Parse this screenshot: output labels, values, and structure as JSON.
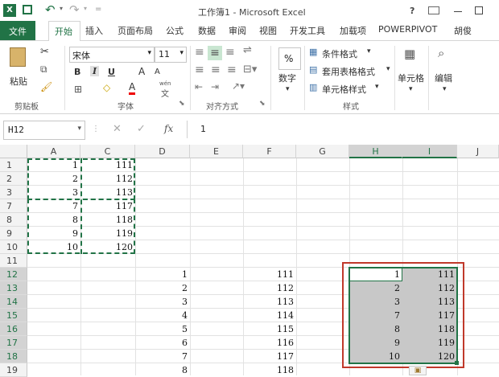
{
  "app": {
    "title": "工作簿1 - Microsoft Excel",
    "help": "?"
  },
  "tabs": [
    "文件",
    "开始",
    "插入",
    "页面布局",
    "公式",
    "数据",
    "审阅",
    "视图",
    "开发工具",
    "加载项",
    "POWERPIVOT",
    "胡俊"
  ],
  "ribbon": {
    "clipboard": {
      "paste": "粘贴",
      "label": "剪贴板"
    },
    "font": {
      "name": "宋体",
      "size": "11",
      "bold": "B",
      "italic": "I",
      "underline": "U",
      "grow": "A",
      "shrink": "A",
      "color_a": "A",
      "label": "字体",
      "wen": "wén",
      "wen_char": "文"
    },
    "alignment": {
      "label": "对齐方式"
    },
    "number": {
      "percent": "%",
      "label": "数字"
    },
    "styles": {
      "conditional": "条件格式",
      "table": "套用表格格式",
      "cell": "单元格样式",
      "label": "样式"
    },
    "cells": {
      "label": "单元格"
    },
    "editing": {
      "label": "编辑"
    }
  },
  "formula_bar": {
    "name_box": "H12",
    "fx": "fx",
    "value": "1"
  },
  "columns": [
    "A",
    "C",
    "D",
    "E",
    "F",
    "G",
    "H",
    "I",
    "J"
  ],
  "row_headers": [
    "1",
    "2",
    "3",
    "7",
    "8",
    "9",
    "10",
    "11",
    "12",
    "13",
    "14",
    "15",
    "16",
    "17",
    "18",
    "19"
  ],
  "colA": [
    "1",
    "2",
    "3",
    "7",
    "8",
    "9",
    "10"
  ],
  "colC": [
    "111",
    "112",
    "113",
    "117",
    "118",
    "119",
    "120"
  ],
  "colD": [
    "1",
    "2",
    "3",
    "4",
    "5",
    "6",
    "7",
    "8"
  ],
  "colF": [
    "111",
    "112",
    "113",
    "114",
    "115",
    "116",
    "117",
    "118"
  ],
  "colH": [
    "1",
    "2",
    "3",
    "7",
    "8",
    "9",
    "10"
  ],
  "colI": [
    "111",
    "112",
    "113",
    "117",
    "118",
    "119",
    "120"
  ],
  "colors": {
    "accent": "#217346",
    "highlight_border": "#c0392b"
  }
}
